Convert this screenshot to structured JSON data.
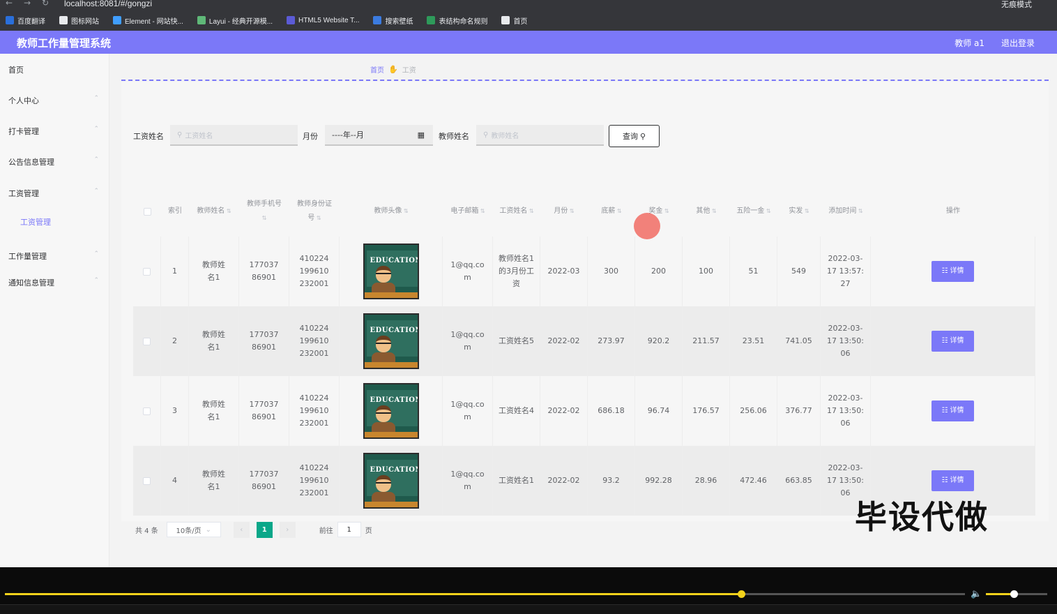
{
  "browser": {
    "url": "localhost:8081/#/gongzi",
    "incognito": "无痕模式"
  },
  "bookmarks": [
    {
      "label": "百度翻译",
      "color": "#2a6fdb"
    },
    {
      "label": "图标网站",
      "color": "#e8eaed"
    },
    {
      "label": "Element - 网站快...",
      "color": "#409eff"
    },
    {
      "label": "Layui - 经典开源模...",
      "color": "#5fb878"
    },
    {
      "label": "HTML5 Website T...",
      "color": "#5b5bd6"
    },
    {
      "label": "搜索壁纸",
      "color": "#3b7be0"
    },
    {
      "label": "表结构命名规则",
      "color": "#2e9a5a"
    },
    {
      "label": "首页",
      "color": "#e8eaed"
    }
  ],
  "header": {
    "title": "教师工作量管理系统",
    "user": "教师 a1",
    "logout": "退出登录"
  },
  "sidebar": {
    "items": [
      "首页",
      "个人中心",
      "打卡管理",
      "公告信息管理",
      "工资管理",
      "工作量管理",
      "通知信息管理"
    ],
    "sub_item": "工资管理"
  },
  "breadcrumb": {
    "home": "首页",
    "current": "工资"
  },
  "filters": {
    "salary_name_label": "工资姓名",
    "salary_name_placeholder": "工资姓名",
    "month_label": "月份",
    "month_value": "----年--月",
    "teacher_name_label": "教师姓名",
    "teacher_name_placeholder": "教师姓名",
    "query": "查询"
  },
  "table": {
    "headers": [
      "索引",
      "教师姓名",
      "教师手机号",
      "教师身份证号",
      "教师头像",
      "电子邮箱",
      "工资姓名",
      "月份",
      "底薪",
      "奖金",
      "其他",
      "五险一金",
      "实发",
      "添加时间",
      "操作"
    ],
    "avatar_text": "EDUCATION",
    "detail_label": "详情",
    "rows": [
      {
        "index": "1",
        "name": "教师姓名1",
        "phone": "17703786901",
        "id": "410224199610232001",
        "email": "1@qq.com",
        "salary_name": "教师姓名1的3月份工资",
        "month": "2022-03",
        "base": "300",
        "bonus": "200",
        "other": "100",
        "insurance": "51",
        "net": "549",
        "time": "2022-03-17 13:57:27"
      },
      {
        "index": "2",
        "name": "教师姓名1",
        "phone": "17703786901",
        "id": "410224199610232001",
        "email": "1@qq.com",
        "salary_name": "工资姓名5",
        "month": "2022-02",
        "base": "273.97",
        "bonus": "920.2",
        "other": "211.57",
        "insurance": "23.51",
        "net": "741.05",
        "time": "2022-03-17 13:50:06"
      },
      {
        "index": "3",
        "name": "教师姓名1",
        "phone": "17703786901",
        "id": "410224199610232001",
        "email": "1@qq.com",
        "salary_name": "工资姓名4",
        "month": "2022-02",
        "base": "686.18",
        "bonus": "96.74",
        "other": "176.57",
        "insurance": "256.06",
        "net": "376.77",
        "time": "2022-03-17 13:50:06"
      },
      {
        "index": "4",
        "name": "教师姓名1",
        "phone": "17703786901",
        "id": "410224199610232001",
        "email": "1@qq.com",
        "salary_name": "工资姓名1",
        "month": "2022-02",
        "base": "93.2",
        "bonus": "992.28",
        "other": "28.96",
        "insurance": "472.46",
        "net": "663.85",
        "time": "2022-03-17 13:50:06"
      }
    ]
  },
  "pagination": {
    "total": "共 4 条",
    "page_size": "10条/页",
    "current": "1",
    "goto_label": "前往",
    "goto_value": "1",
    "page_suffix": "页"
  },
  "watermark": "毕设代做",
  "player": {
    "progress": 0.767,
    "volume": 0.45,
    "accent": "#f3d21b"
  }
}
